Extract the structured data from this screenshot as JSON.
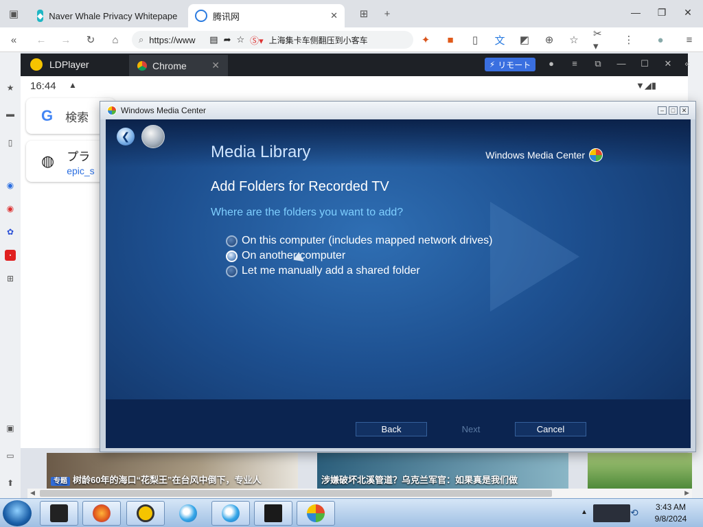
{
  "browser": {
    "tabs": [
      {
        "title": "Naver Whale Privacy Whitepape",
        "active": false
      },
      {
        "title": "腾讯网",
        "active": true
      }
    ],
    "address_url": "https://www",
    "search_suggest": "上海集卡车侧翻压到小客车",
    "new_tab_symbol": "+"
  },
  "ldplayer": {
    "app_name": "LDPlayer",
    "tab_label": "Chrome",
    "remote_label": "リモート"
  },
  "android": {
    "time": "16:44",
    "search_placeholder": "検索",
    "card_title": "プラ",
    "card_sub": "epic_s"
  },
  "wmc": {
    "window_title": "Windows Media Center",
    "brand": "Windows Media Center",
    "section": "Media Library",
    "heading": "Add Folders for Recorded TV",
    "question": "Where are the folders you want to add?",
    "options": [
      {
        "label": "On this computer (includes mapped network drives)",
        "selected": false
      },
      {
        "label": "On another computer",
        "selected": true
      },
      {
        "label": "Let me manually add a shared folder",
        "selected": false
      }
    ],
    "buttons": {
      "back": "Back",
      "next": "Next",
      "cancel": "Cancel"
    },
    "next_enabled": false
  },
  "news": {
    "item1_badge": "专题",
    "item1": "树龄60年的海口“花梨王”在台风中倒下，专业人",
    "item2": "涉嫌破坏北溪管道？乌克兰军官：如果真是我们做"
  },
  "taskbar": {
    "time": "3:43 AM",
    "date": "9/8/2024"
  }
}
